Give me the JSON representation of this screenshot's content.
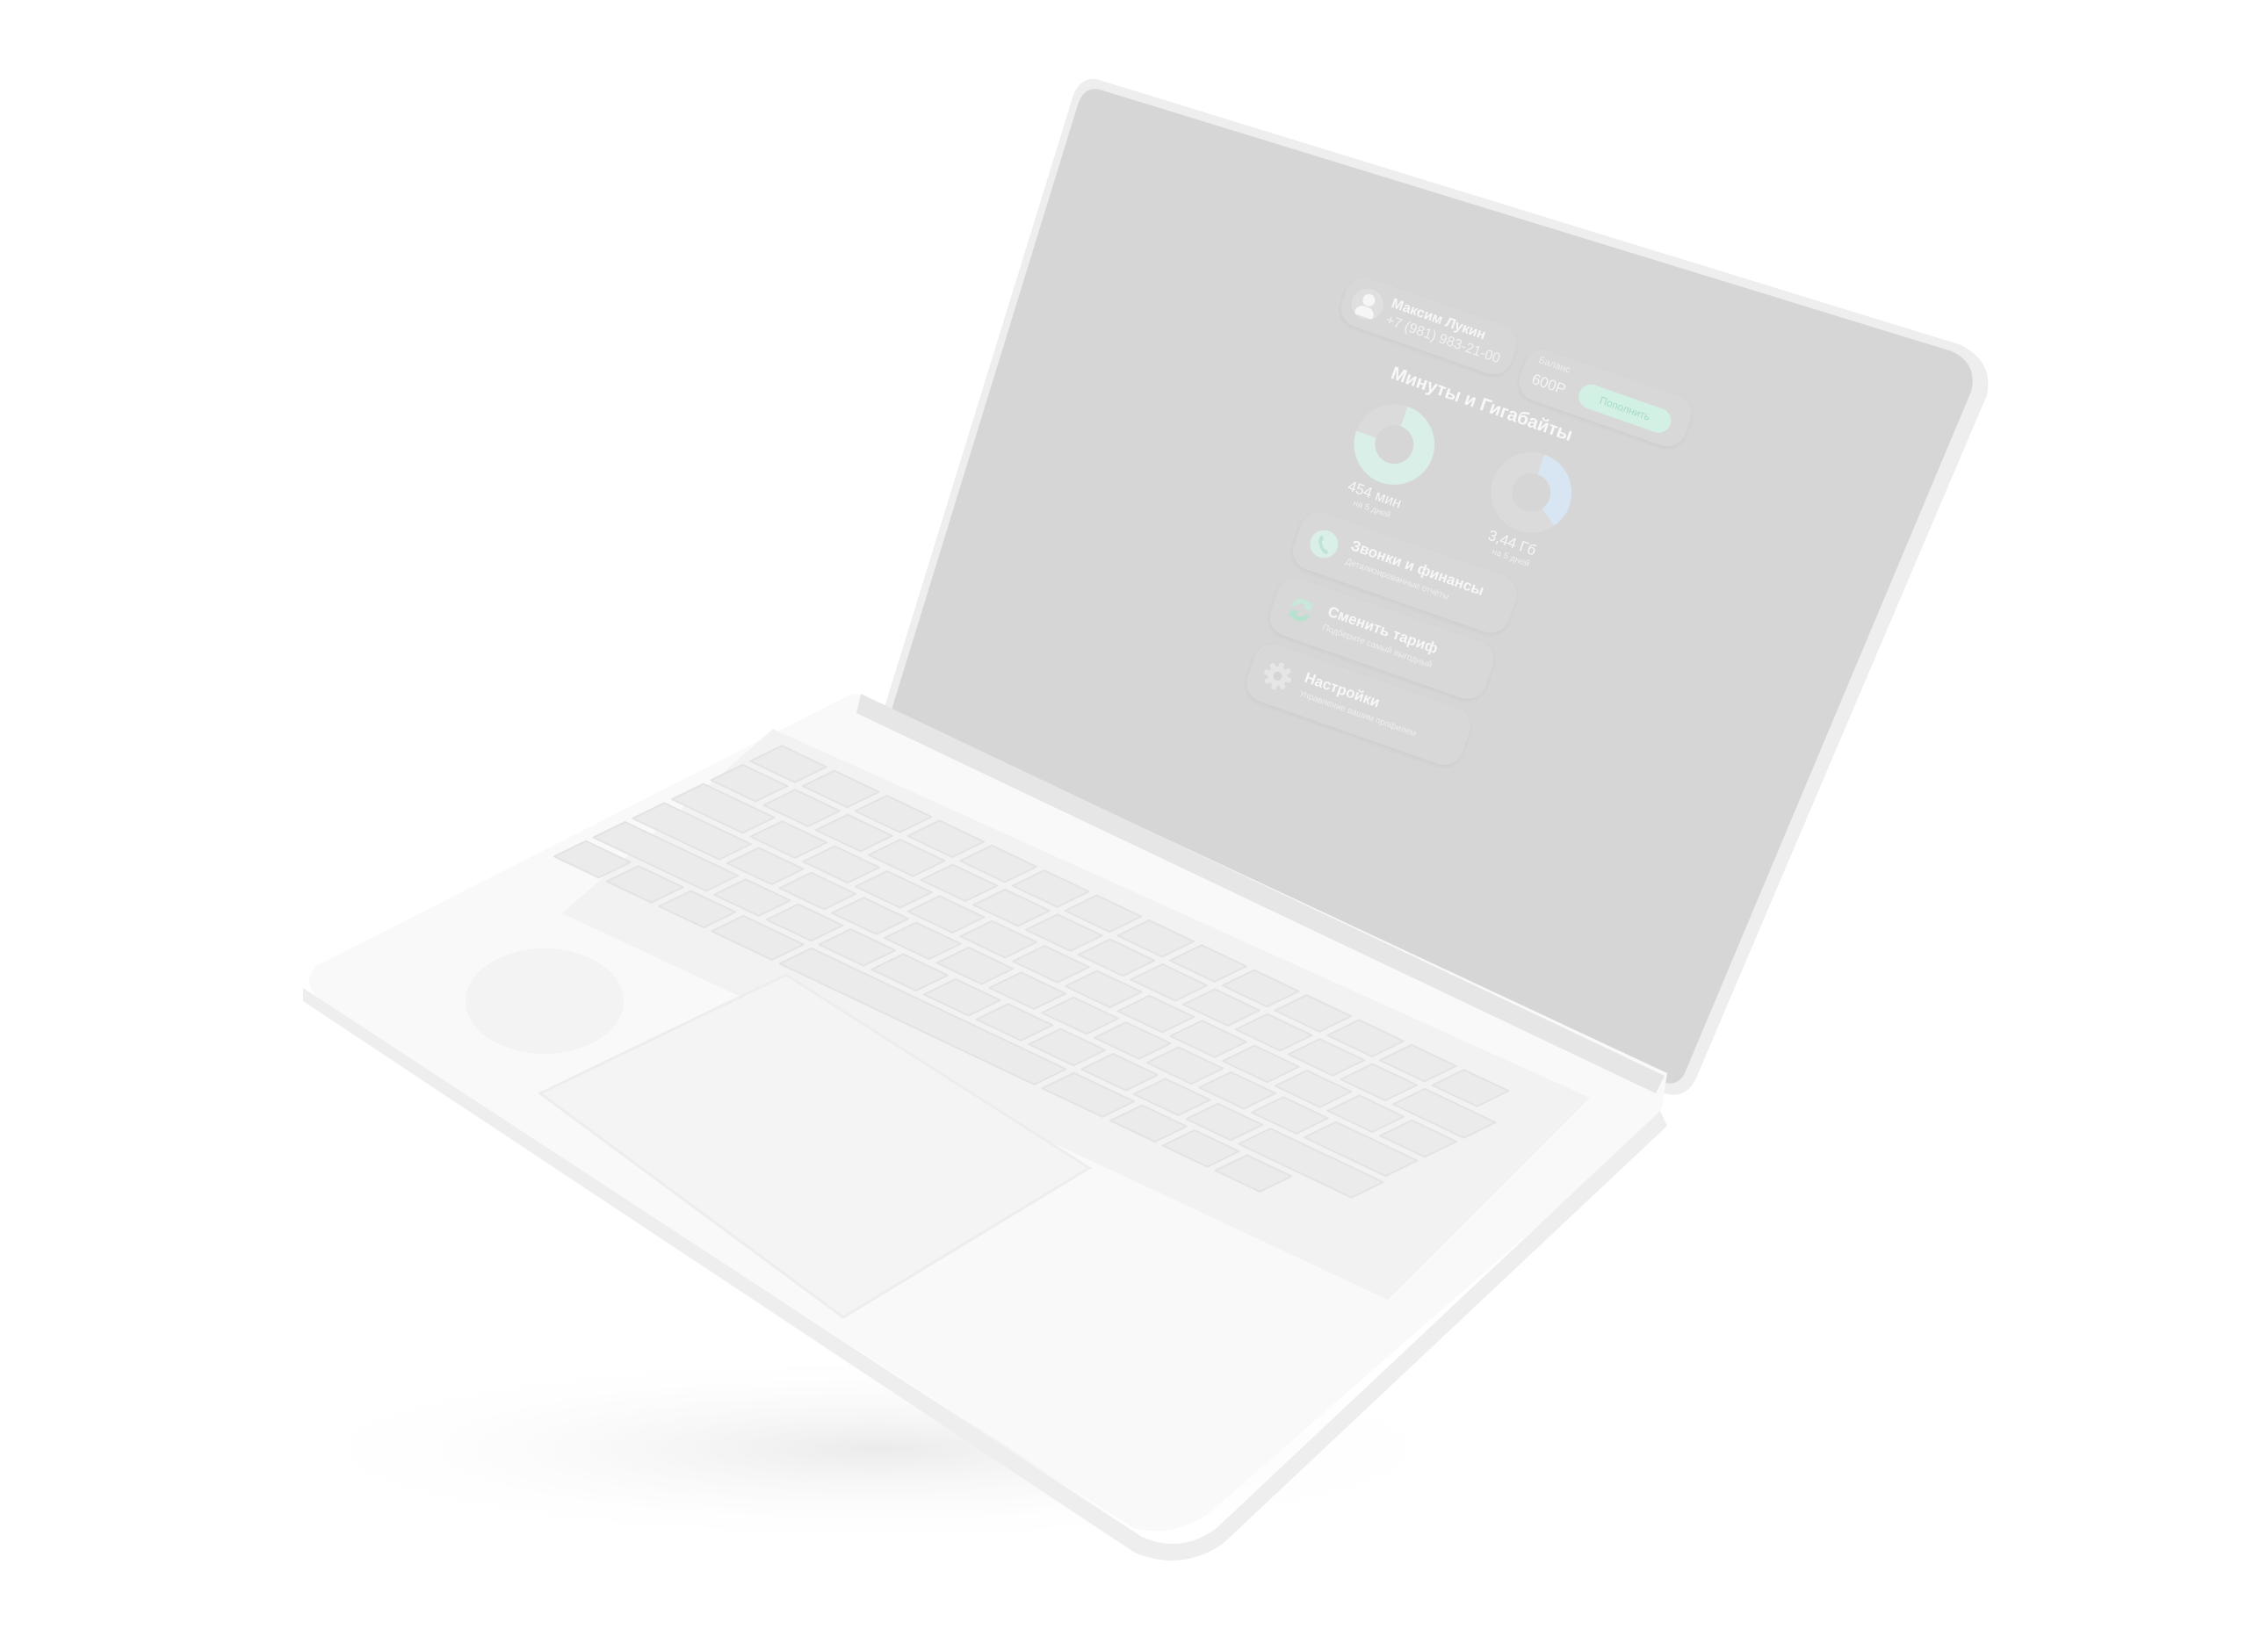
{
  "user": {
    "name": "Максим Лукин",
    "phone": "+7 (981) 983-21-00"
  },
  "balance": {
    "label": "Баланс",
    "value": "600Р",
    "topup_label": "Пополнить"
  },
  "section_title": "Минуты и Гигабайты",
  "usage": {
    "minutes": {
      "value": "454 мин",
      "sub": "на 5 дней",
      "fill_fraction": 0.75,
      "color": "#d9efe7"
    },
    "gigabytes": {
      "value": "3,44 Гб",
      "sub": "на 5 дней",
      "fill_fraction": 0.35,
      "color": "#d8e6f4"
    }
  },
  "menu": [
    {
      "title": "Звонки и финансы",
      "sub": "Детализированные отчёты",
      "icon": "phone-icon",
      "accent": "#d9efe7"
    },
    {
      "title": "Сменить тариф",
      "sub": "Подберите самый выгодный",
      "icon": "swap-arrows-icon",
      "accent": "#d9efe7"
    },
    {
      "title": "Настройки",
      "sub": "Управление вашим профилем",
      "icon": "gear-icon",
      "accent": "#e4e4e4"
    }
  ],
  "colors": {
    "screen": "#d6d6d6",
    "body": "#f9f9f9",
    "keys": "#ebebeb"
  }
}
